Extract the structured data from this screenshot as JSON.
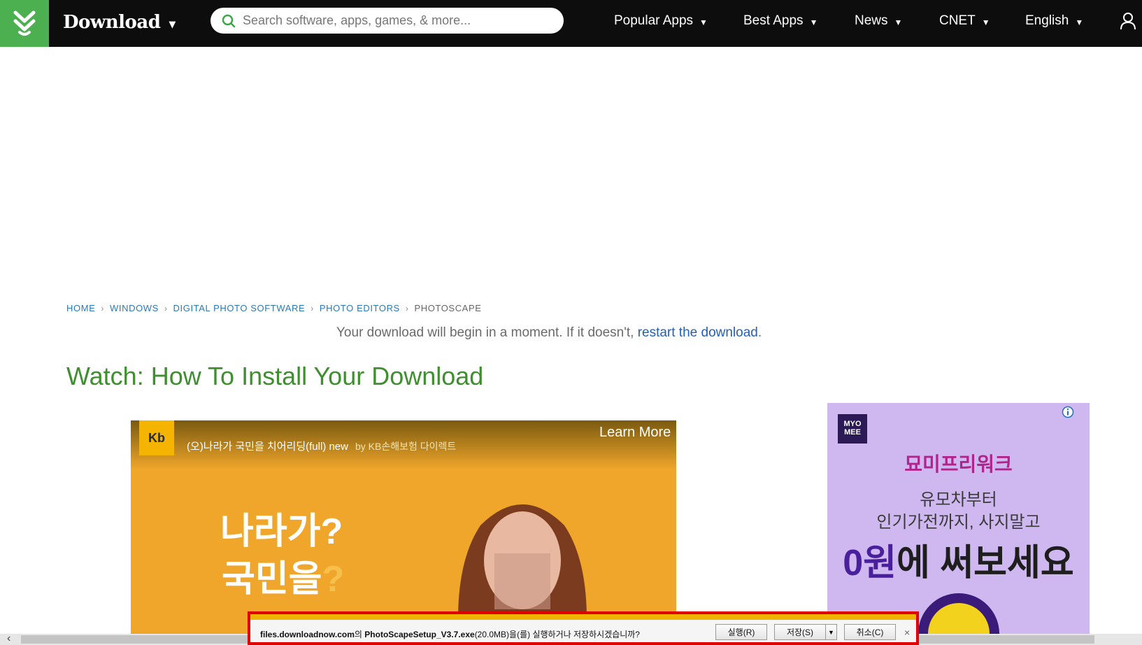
{
  "header": {
    "brand": "Download",
    "search_placeholder": "Search software, apps, games, & more...",
    "nav": [
      {
        "label": "Popular Apps"
      },
      {
        "label": "Best Apps"
      },
      {
        "label": "News"
      },
      {
        "label": "CNET"
      },
      {
        "label": "English"
      }
    ],
    "logo_color": "#4caf50"
  },
  "breadcrumb": {
    "items": [
      "HOME",
      "WINDOWS",
      "DIGITAL PHOTO SOFTWARE",
      "PHOTO EDITORS"
    ],
    "current": "PHOTOSCAPE"
  },
  "download_message": {
    "text": "Your download will begin in a moment. If it doesn't, ",
    "link": "restart the download",
    "suffix": "."
  },
  "watch_title": "Watch: How To Install Your Download",
  "video_ad": {
    "title": "(오)나라가 국민을 치어리딩(full) new",
    "by": "by KB손해보험 다이렉트",
    "learn_more": "Learn More",
    "line1": "나라가?",
    "line2": "국민을",
    "line2_q": "?",
    "logo": "Kb"
  },
  "side_ad": {
    "logo": "MYO MEE",
    "brand": "묘미프리워크",
    "line1": "유모차부터",
    "line2": "인기가전까지, 사지말고",
    "line3_zero": "0원",
    "line3_rest": "에 써보세요"
  },
  "download_bar": {
    "domain": "files.downloadnow.com",
    "particle": "의 ",
    "filename": "PhotoScapeSetup_V3.7.exe",
    "size": "(20.0MB)",
    "question": "을(를) 실행하거나 저장하시겠습니까?",
    "run_label": "실행(R)",
    "save_label": "저장(S)",
    "cancel_label": "취소(C)",
    "close_label": "×"
  }
}
